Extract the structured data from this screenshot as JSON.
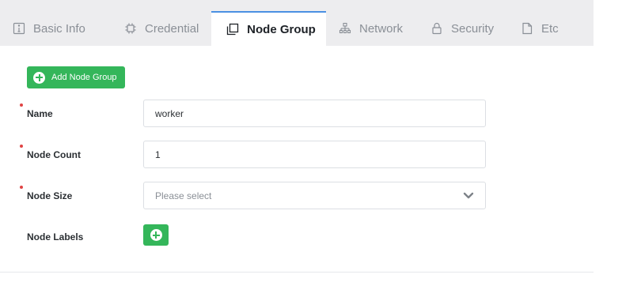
{
  "tabs": [
    {
      "label": "Basic Info",
      "icon": "info-box-icon",
      "active": false
    },
    {
      "label": "Credential",
      "icon": "chip-icon",
      "active": false
    },
    {
      "label": "Node Group",
      "icon": "copy-stack-icon",
      "active": true
    },
    {
      "label": "Network",
      "icon": "network-tree-icon",
      "active": false
    },
    {
      "label": "Security",
      "icon": "lock-icon",
      "active": false
    },
    {
      "label": "Etc",
      "icon": "document-icon",
      "active": false
    }
  ],
  "add_node_group": {
    "label": "Add Node Group",
    "icon": "plus-circle-icon"
  },
  "form": {
    "name": {
      "label": "Name",
      "value": "worker",
      "required": true
    },
    "node_count": {
      "label": "Node Count",
      "value": "1",
      "required": true
    },
    "node_size": {
      "label": "Node Size",
      "placeholder": "Please select",
      "required": true
    },
    "node_labels": {
      "label": "Node Labels",
      "required": false
    }
  },
  "colors": {
    "accent_green": "#34b65a",
    "active_tab_border": "#4a90e2",
    "required_marker": "#e04444",
    "tabbar_bg": "#ededef"
  }
}
